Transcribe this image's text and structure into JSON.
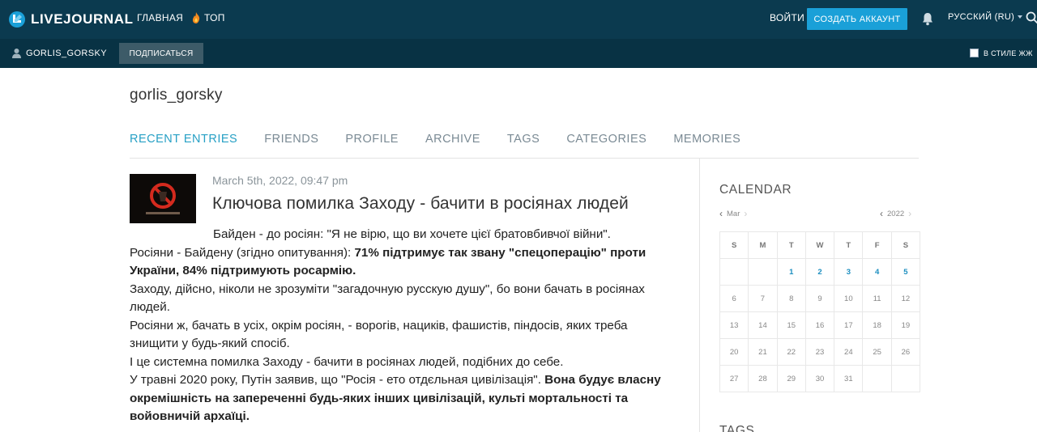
{
  "topbar": {
    "logo_text": "LIVEJOURNAL",
    "nav_home": "ГЛАВНАЯ",
    "nav_top": "ТОП",
    "login": "ВОЙТИ",
    "create_account": "СОЗДАТЬ АККАУНТ",
    "language": "РУССКИЙ (RU)"
  },
  "subbar": {
    "username": "GORLIS_GORSKY",
    "subscribe": "ПОДПИСАТЬСЯ",
    "style_toggle": "В СТИЛЕ ЖЖ"
  },
  "journal": {
    "name": "gorlis_gorsky",
    "tabs": [
      {
        "label": "RECENT ENTRIES",
        "active": true
      },
      {
        "label": "FRIENDS"
      },
      {
        "label": "PROFILE"
      },
      {
        "label": "ARCHIVE"
      },
      {
        "label": "TAGS"
      },
      {
        "label": "CATEGORIES"
      },
      {
        "label": "MEMORIES"
      }
    ]
  },
  "entry": {
    "date": "March 5th, 2022, 09:47 pm",
    "title": "Ключова помилка Заходу - бачити в росіянах людей",
    "p1": "Байден - до росіян: \"Я не вірю, що ви хочете цієї братовбивчої війни\".",
    "p2a": "Росіяни - Байдену (згідно опитування): ",
    "p2b": "71% підтримує так звану \"спецоперацію\" проти України, 84% підтримують росармію.",
    "p3": "Заходу, дійсно, ніколи не зрозуміти \"загадочную русскую душу\", бо вони бачать в росіянах людей.",
    "p4": "Росіяни ж, бачать в усіх, окрім росіян, - ворогів, нациків, фашистів, піндосів, яких треба знищити у будь-який спосіб.",
    "p5": "І це системна помилка Заходу - бачити в росіянах людей, подібних до себе.",
    "p6a": "У травні 2020 року, Путін заявив, що \"Росія - ето отдєльная цивілізація\". ",
    "p6b": "Вона будує власну окремішність на запереченні будь-яких інших цивілізацій, культі мортальності та войовничій архаїці."
  },
  "calendar": {
    "title": "CALENDAR",
    "month": "Mar",
    "year": "2022",
    "weekdays": [
      "S",
      "M",
      "T",
      "W",
      "T",
      "F",
      "S"
    ],
    "weeks": [
      [
        "",
        "",
        "1",
        "2",
        "3",
        "4",
        "5"
      ],
      [
        "6",
        "7",
        "8",
        "9",
        "10",
        "11",
        "12"
      ],
      [
        "13",
        "14",
        "15",
        "16",
        "17",
        "18",
        "19"
      ],
      [
        "20",
        "21",
        "22",
        "23",
        "24",
        "25",
        "26"
      ],
      [
        "27",
        "28",
        "29",
        "30",
        "31",
        "",
        ""
      ]
    ],
    "linked_days": [
      "1",
      "2",
      "3",
      "4",
      "5"
    ]
  },
  "sidebar": {
    "tags_title": "TAGS"
  },
  "colors": {
    "topbar": "#0b3a4f",
    "subbar": "#083244",
    "accent": "#1aa0d8",
    "active_tab": "#27a0c5"
  }
}
